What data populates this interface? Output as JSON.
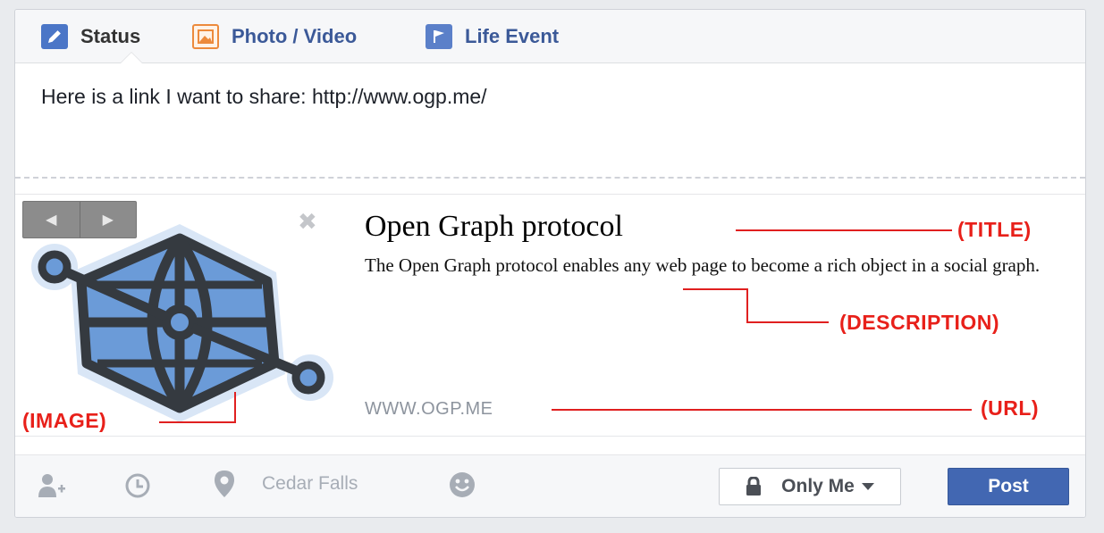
{
  "tabs": [
    {
      "label": "Status",
      "icon": "pencil-icon",
      "active": true
    },
    {
      "label": "Photo / Video",
      "icon": "photo-icon",
      "active": false
    },
    {
      "label": "Life Event",
      "icon": "flag-icon",
      "active": false
    }
  ],
  "composer": {
    "message": "Here is a link I want to share:  http://www.ogp.me/"
  },
  "preview": {
    "title": "Open Graph protocol",
    "description": "The Open Graph protocol enables any web page to become a rich object in a social graph.",
    "url": "WWW.OGP.ME",
    "pager": {
      "prev_icon": "triangle-left-icon",
      "next_icon": "triangle-right-icon"
    },
    "close_icon": "close-icon",
    "image_icon": "open-graph-logo"
  },
  "annotations": {
    "title": "(TITLE)",
    "description": "(DESCRIPTION)",
    "url": "(URL)",
    "image": "(IMAGE)"
  },
  "footer": {
    "tag_friends_icon": "add-person-icon",
    "time_icon": "clock-icon",
    "location_icon": "map-pin-icon",
    "location": "Cedar Falls",
    "feeling_icon": "smiley-icon",
    "privacy": "Only Me",
    "privacy_icon": "lock-icon",
    "post": "Post"
  },
  "colors": {
    "brand_blue": "#3b5998",
    "post_button": "#4267b2",
    "annotation_red": "#e8201a",
    "og_logo_fill": "#6b9bd8",
    "og_logo_stroke": "#353a40"
  }
}
